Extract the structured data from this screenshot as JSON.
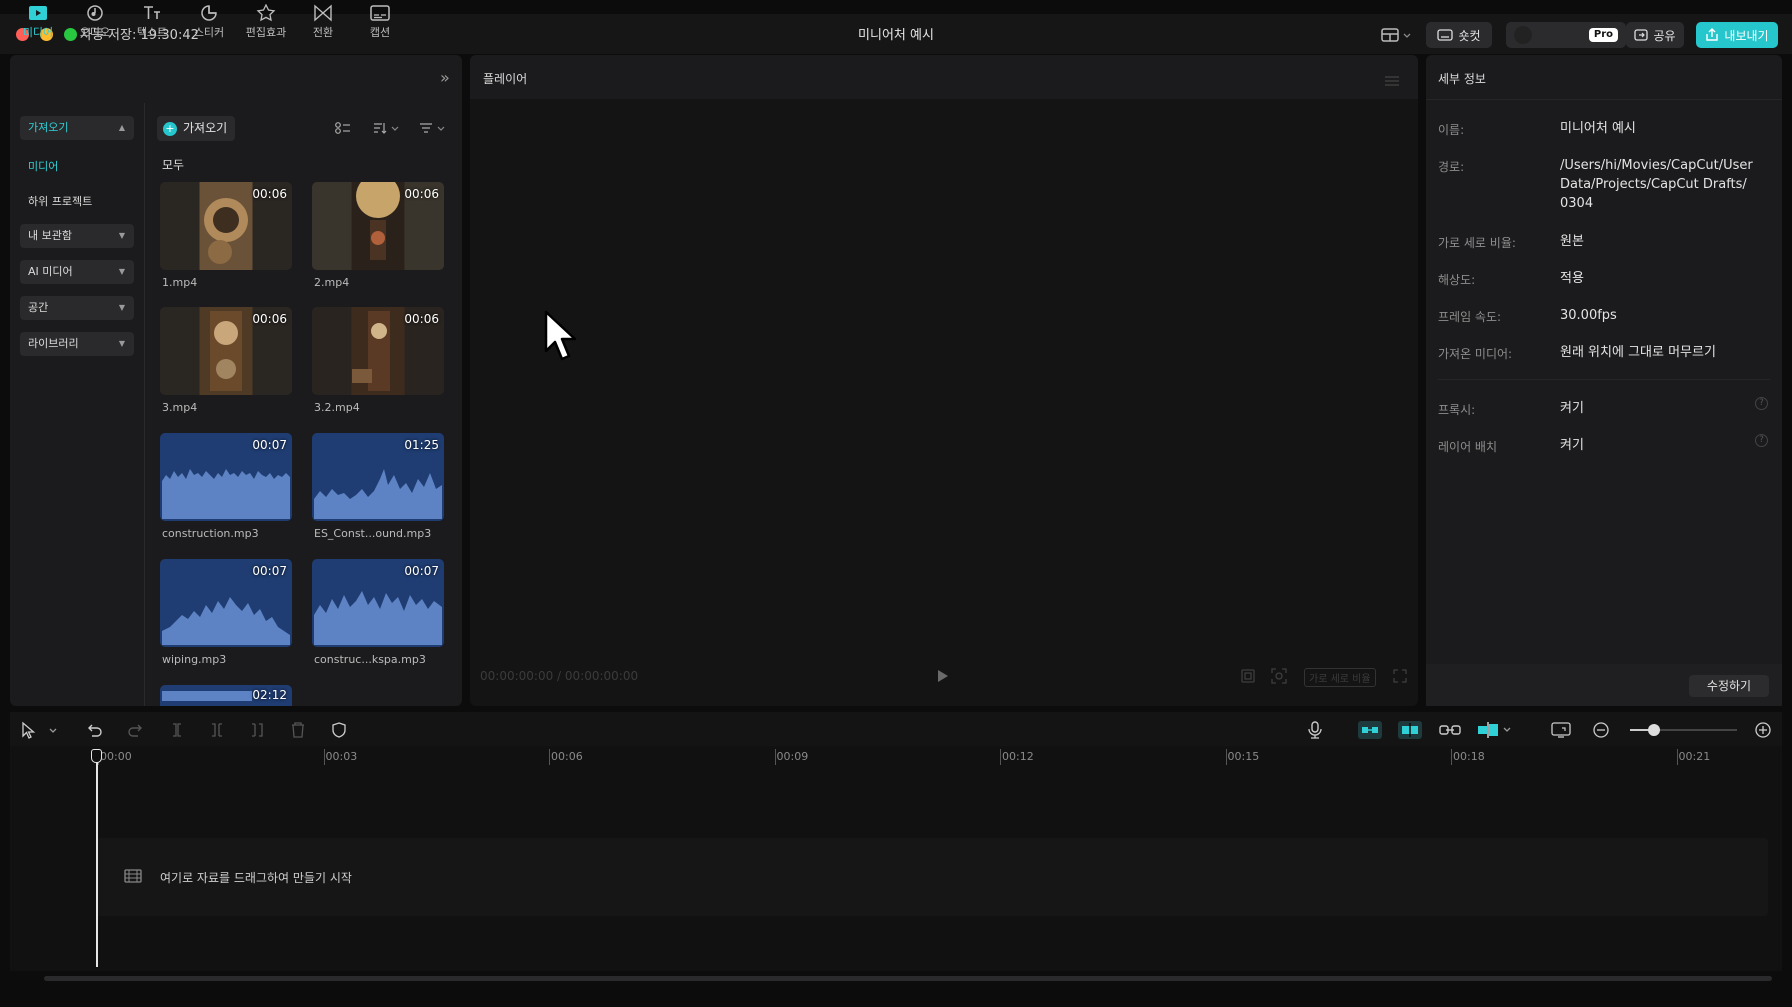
{
  "window": {
    "autosave_text": "자동 저장: 19:30:42",
    "title": "미니어처 예시"
  },
  "topbar": {
    "shortcut_label": "숏컷",
    "pro_badge": "Pro",
    "share_label": "공유",
    "export_label": "내보내기",
    "accent_color": "#26c6cd"
  },
  "toolbar": {
    "items": [
      {
        "label": "미디어",
        "icon": "media-icon",
        "active": true
      },
      {
        "label": "오디오",
        "icon": "audio-icon"
      },
      {
        "label": "텍스트",
        "icon": "text-icon"
      },
      {
        "label": "스티커",
        "icon": "sticker-icon"
      },
      {
        "label": "편집효과",
        "icon": "effects-icon"
      },
      {
        "label": "전환",
        "icon": "transition-icon"
      },
      {
        "label": "캡션",
        "icon": "caption-icon"
      }
    ]
  },
  "sidebar": {
    "import_label": "가져오기",
    "media_label": "미디어",
    "subproject_label": "하위 프로젝트",
    "my_library_label": "내 보관함",
    "ai_media_label": "AI 미디어",
    "space_label": "공간",
    "library_label": "라이브러리"
  },
  "media": {
    "import_button": "가져오기",
    "section_label": "모두",
    "items": [
      {
        "name": "1.mp4",
        "duration": "00:06"
      },
      {
        "name": "2.mp4",
        "duration": "00:06"
      },
      {
        "name": "3.mp4",
        "duration": "00:06"
      },
      {
        "name": "3.2.mp4",
        "duration": "00:06"
      },
      {
        "name": "construction.mp3",
        "duration": "00:07"
      },
      {
        "name": "ES_Const...ound.mp3",
        "duration": "01:25"
      },
      {
        "name": "wiping.mp3",
        "duration": "00:07"
      },
      {
        "name": "construc...kspa.mp3",
        "duration": "00:07"
      },
      {
        "name": "",
        "duration": "02:12"
      }
    ]
  },
  "player": {
    "title": "플레이어",
    "current_time": "00:00:00:00",
    "total_time": "00:00:00:00",
    "ratio_label": "가로 세로 비율"
  },
  "details": {
    "title": "세부 정보",
    "name_label": "이름:",
    "name_value": "미니어처 예시",
    "path_label": "경로:",
    "path_value": "/Users/hi/Movies/CapCut/User Data/Projects/CapCut Drafts/ 0304",
    "ratio_label": "가로 세로 비율:",
    "ratio_value": "원본",
    "resolution_label": "해상도:",
    "resolution_value": "적용",
    "framerate_label": "프레임 속도:",
    "framerate_value": "30.00fps",
    "imported_label": "가져온 미디어:",
    "imported_value": "원래 위치에 그대로 머무르기",
    "proxy_label": "프록시:",
    "proxy_value": "켜기",
    "layer_label": "레이어 배치",
    "layer_value": "켜기",
    "modify_button": "수정하기"
  },
  "timeline": {
    "ticks": [
      "00:00",
      "00:03",
      "00:06",
      "00:09",
      "00:12",
      "00:15",
      "00:18",
      "00:21"
    ],
    "drop_hint": "여기로 자료를 드래그하여 만들기 시작"
  }
}
